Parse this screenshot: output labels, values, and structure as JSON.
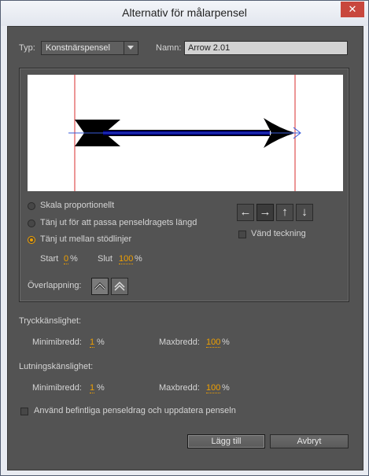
{
  "window": {
    "title": "Alternativ för målarpensel",
    "close": "✕"
  },
  "type": {
    "label": "Typ:",
    "value": "Konstnärspensel"
  },
  "name": {
    "label": "Namn:",
    "value": "Arrow 2.01"
  },
  "scale_options": [
    {
      "label": "Skala proportionellt",
      "selected": false
    },
    {
      "label": "Tänj ut för att passa penseldragets längd",
      "selected": false
    },
    {
      "label": "Tänj ut mellan stödlinjer",
      "selected": true
    }
  ],
  "guides": {
    "start_label": "Start",
    "start_value": "0",
    "end_label": "Slut",
    "end_value": "100",
    "unit": "%"
  },
  "direction": {
    "buttons": [
      {
        "icon": "arrow-left-icon",
        "glyph": "←"
      },
      {
        "icon": "arrow-right-icon",
        "glyph": "→",
        "selected": true
      },
      {
        "icon": "arrow-up-icon",
        "glyph": "↑"
      },
      {
        "icon": "arrow-down-icon",
        "glyph": "↓"
      }
    ],
    "flip_label": "Vänd teckning"
  },
  "overlap": {
    "label": "Överlappning:"
  },
  "pressure": {
    "heading": "Tryckkänslighet:",
    "min_label": "Minimibredd:",
    "min_value": "1",
    "max_label": "Maxbredd:",
    "max_value": "100",
    "unit": "%"
  },
  "tilt": {
    "heading": "Lutningskänslighet:",
    "min_label": "Minimibredd:",
    "min_value": "1",
    "max_label": "Maxbredd:",
    "max_value": "100",
    "unit": "%"
  },
  "apply_existing": {
    "label": "Använd befintliga penseldrag och uppdatera penseln"
  },
  "buttons": {
    "add": "Lägg till",
    "cancel": "Avbryt"
  },
  "colors": {
    "accent": "#f0a000",
    "guide": "#e05050",
    "arrow_shaft": "#00008b",
    "path": "#3a5bd9"
  }
}
